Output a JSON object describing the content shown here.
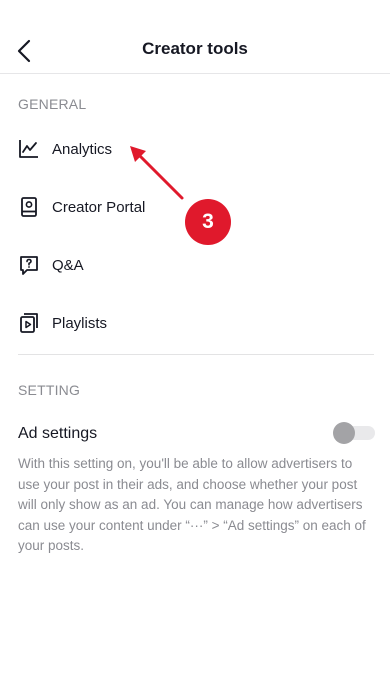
{
  "header": {
    "title": "Creator tools",
    "back_icon": "chevron-left-icon"
  },
  "general": {
    "section_label": "GENERAL",
    "items": [
      {
        "label": "Analytics",
        "icon": "analytics-chart-icon"
      },
      {
        "label": "Creator Portal",
        "icon": "creator-portal-icon"
      },
      {
        "label": "Q&A",
        "icon": "qa-icon"
      },
      {
        "label": "Playlists",
        "icon": "playlist-icon"
      }
    ]
  },
  "setting": {
    "section_label": "SETTING",
    "ad_settings_label": "Ad settings",
    "ad_settings_enabled": false,
    "ad_settings_description": "With this setting on, you'll be able to allow advertisers to use your post in their ads, and choose whether your post will only show as an ad. You can manage how advertisers can use your content under “···” > “Ad settings” on each of your posts."
  },
  "annotation": {
    "badge_text": "3",
    "color": "#e0192c"
  },
  "colors": {
    "text": "#161823",
    "secondary": "#8a8b91",
    "divider": "#e3e3e4"
  }
}
